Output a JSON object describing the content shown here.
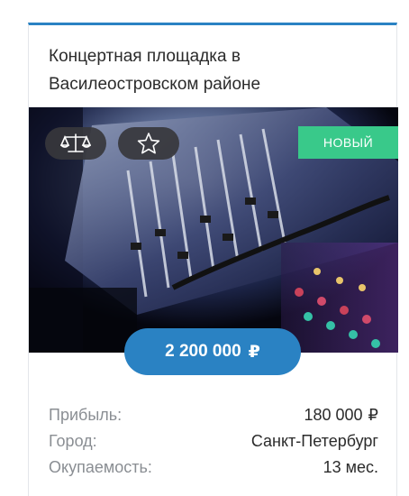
{
  "listing": {
    "title": "Концертная площадка в Василеостровском районе",
    "badge": "НОВЫЙ",
    "price": "2 200 000",
    "currency": "₽"
  },
  "icons": {
    "compare": "scales-icon",
    "favorite": "star-icon"
  },
  "details": {
    "profit_label": "Прибыль:",
    "profit_value": "180 000",
    "profit_currency": "₽",
    "city_label": "Город:",
    "city_value": "Санкт-Петербург",
    "payback_label": "Окупаемость:",
    "payback_value": "13 мес."
  },
  "colors": {
    "accent": "#2a82c3",
    "badge": "#39c98a",
    "pill": "#37373c"
  }
}
